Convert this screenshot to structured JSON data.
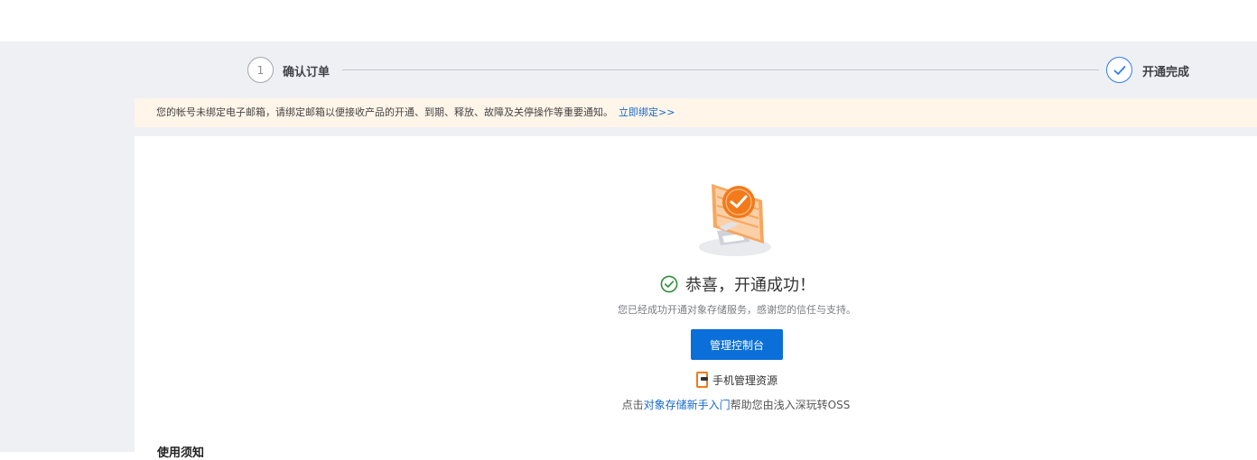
{
  "steps": [
    {
      "number": "1",
      "label": "确认订单",
      "state": "done"
    },
    {
      "label": "开通完成",
      "state": "current",
      "icon": "check-icon"
    }
  ],
  "notice": {
    "text": "您的帐号未绑定电子邮箱，请绑定邮箱以便接收产品的开通、到期、释放、故障及关停操作等重要通知。",
    "link": "立即绑定>>"
  },
  "success": {
    "title": "恭喜，开通成功！",
    "description": "您已经成功开通对象存储服务，感谢您的信任与支持。",
    "console_button": "管理控制台",
    "mobile_link": "手机管理资源",
    "guide_prefix": "点击",
    "guide_link": "对象存储新手入门",
    "guide_suffix": "帮助您由浅入深玩转OSS"
  },
  "usage_title": "使用须知",
  "colors": {
    "primary": "#0a6fd8",
    "link": "#1769cc",
    "success": "#2f8f3a",
    "notice_bg": "#fff5e9",
    "illustration": "#f27a1a"
  }
}
